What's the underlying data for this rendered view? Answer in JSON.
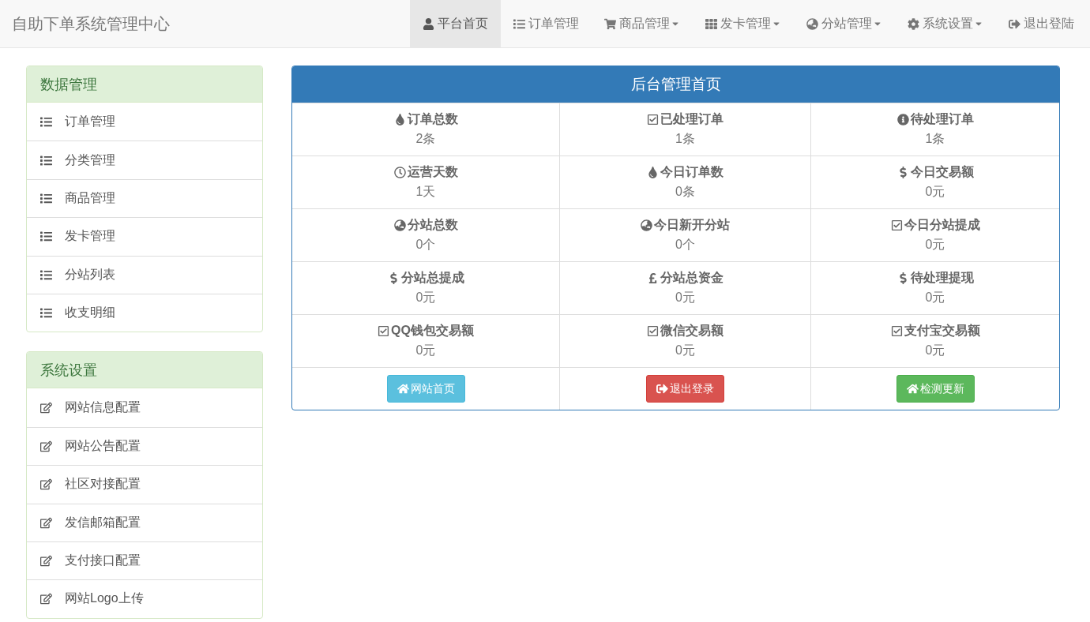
{
  "brand": "自助下单系统管理中心",
  "nav": [
    {
      "label": "平台首页",
      "selected": true,
      "dropdown": false
    },
    {
      "label": "订单管理",
      "selected": false,
      "dropdown": false
    },
    {
      "label": "商品管理",
      "selected": false,
      "dropdown": true
    },
    {
      "label": "发卡管理",
      "selected": false,
      "dropdown": true
    },
    {
      "label": "分站管理",
      "selected": false,
      "dropdown": true
    },
    {
      "label": "系统设置",
      "selected": false,
      "dropdown": true
    },
    {
      "label": "退出登陆",
      "selected": false,
      "dropdown": false
    }
  ],
  "sidebar": [
    {
      "title": "数据管理",
      "items": [
        "订单管理",
        "分类管理",
        "商品管理",
        "发卡管理",
        "分站列表",
        "收支明细"
      ]
    },
    {
      "title": "系统设置",
      "items": [
        "网站信息配置",
        "网站公告配置",
        "社区对接配置",
        "发信邮箱配置",
        "支付接口配置",
        "网站Logo上传"
      ]
    }
  ],
  "panel": {
    "title": "后台管理首页",
    "stats": [
      {
        "label": "订单总数",
        "value": "2条"
      },
      {
        "label": "已处理订单",
        "value": "1条"
      },
      {
        "label": "待处理订单",
        "value": "1条"
      },
      {
        "label": "运营天数",
        "value": "1天"
      },
      {
        "label": "今日订单数",
        "value": "0条"
      },
      {
        "label": "今日交易额",
        "value": "0元"
      },
      {
        "label": "分站总数",
        "value": "0个"
      },
      {
        "label": "今日新开分站",
        "value": "0个"
      },
      {
        "label": "今日分站提成",
        "value": "0元"
      },
      {
        "label": "分站总提成",
        "value": "0元"
      },
      {
        "label": "分站总资金",
        "value": "0元"
      },
      {
        "label": "待处理提现",
        "value": "0元"
      },
      {
        "label": "QQ钱包交易额",
        "value": "0元"
      },
      {
        "label": "微信交易额",
        "value": "0元"
      },
      {
        "label": "支付宝交易额",
        "value": "0元"
      }
    ],
    "buttons": [
      {
        "label": "网站首页",
        "kind": "info"
      },
      {
        "label": "退出登录",
        "kind": "danger"
      },
      {
        "label": "检测更新",
        "kind": "success"
      }
    ]
  }
}
